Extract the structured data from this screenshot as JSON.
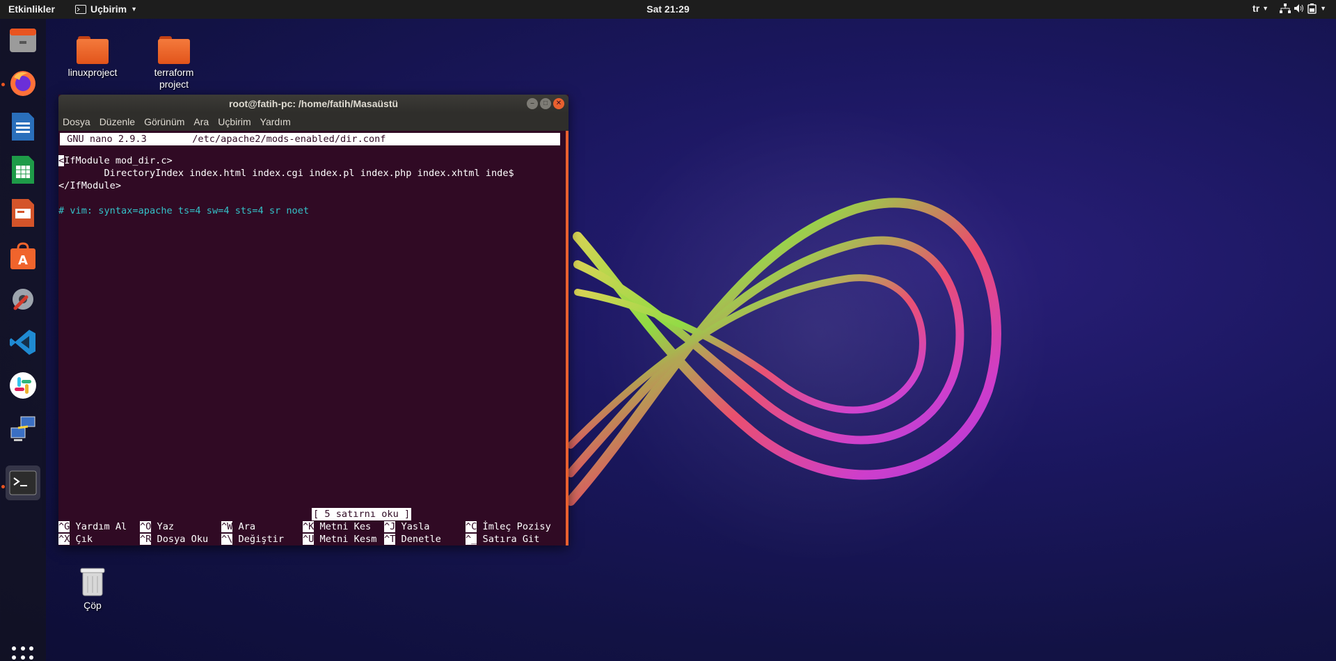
{
  "topbar": {
    "activities": "Etkinlikler",
    "app_menu": "Uçbirim",
    "clock": "Sat 21:29",
    "language": "tr"
  },
  "dock": {
    "items": [
      {
        "name": "files-icon"
      },
      {
        "name": "firefox-icon"
      },
      {
        "name": "writer-icon"
      },
      {
        "name": "calc-icon"
      },
      {
        "name": "impress-icon"
      },
      {
        "name": "software-icon"
      },
      {
        "name": "settings-icon"
      },
      {
        "name": "vscode-icon"
      },
      {
        "name": "slack-icon"
      },
      {
        "name": "network-icon"
      },
      {
        "name": "terminal-icon"
      }
    ]
  },
  "desktop": {
    "icons": [
      {
        "label": "linuxproject"
      },
      {
        "label": "terraform project"
      },
      {
        "label": "Çöp"
      }
    ]
  },
  "terminal": {
    "title": "root@fatih-pc: /home/fatih/Masaüstü",
    "menu": [
      "Dosya",
      "Düzenle",
      "Görünüm",
      "Ara",
      "Uçbirim",
      "Yardım"
    ],
    "nano_header": " GNU nano 2.9.3        /etc/apache2/mods-enabled/dir.conf",
    "lines": {
      "l1_cursor": "<",
      "l1_rest": "IfModule mod_dir.c>",
      "l2": "        DirectoryIndex index.html index.cgi index.pl index.php index.xhtml inde$",
      "l3": "</IfModule>",
      "l4": "# vim: syntax=apache ts=4 sw=4 sts=4 sr noet"
    },
    "status_message": "[ 5 satırnı oku ]",
    "shortcuts_row1": [
      {
        "key": "^G",
        "label": " Yardım Al"
      },
      {
        "key": "^O",
        "label": " Yaz"
      },
      {
        "key": "^W",
        "label": " Ara"
      },
      {
        "key": "^K",
        "label": " Metni Kes"
      },
      {
        "key": "^J",
        "label": " Yasla"
      },
      {
        "key": "^C",
        "label": " İmleç Pozisy"
      }
    ],
    "shortcuts_row2": [
      {
        "key": "^X",
        "label": " Çık"
      },
      {
        "key": "^R",
        "label": " Dosya Oku"
      },
      {
        "key": "^\\",
        "label": " Değiştir"
      },
      {
        "key": "^U",
        "label": " Metni Kesm"
      },
      {
        "key": "^T",
        "label": " Denetle"
      },
      {
        "key": "^_",
        "label": " Satıra Git"
      }
    ]
  },
  "colors": {
    "accent": "#e95420",
    "terminal_bg": "#300a24",
    "comment": "#34c1c8"
  }
}
